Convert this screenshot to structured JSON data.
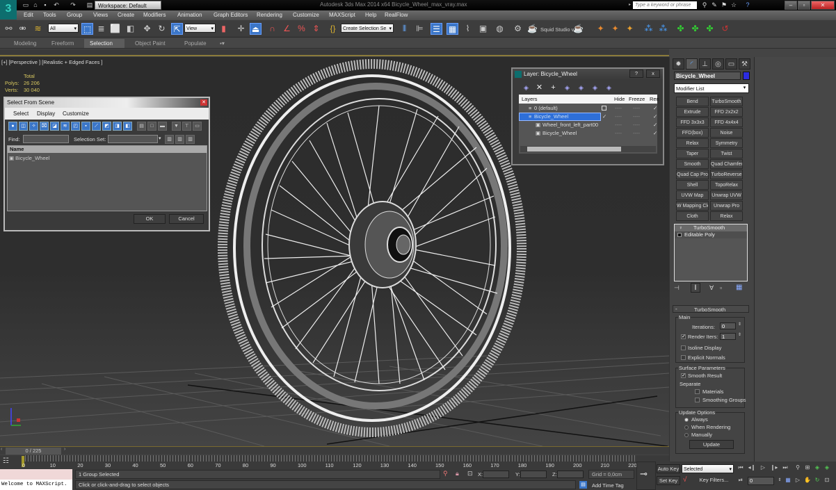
{
  "app": {
    "title": "Autodesk 3ds Max  2014 x64     Bicycle_Wheel_max_vray.max",
    "workspace": "Workspace: Default",
    "search_placeholder": "Type a keyword or phrase",
    "logo": "3"
  },
  "menu": [
    "Edit",
    "Tools",
    "Group",
    "Views",
    "Create",
    "Modifiers",
    "Animation",
    "Graph Editors",
    "Rendering",
    "Customize",
    "MAXScript",
    "Help",
    "RealFlow"
  ],
  "toolbar": {
    "filter": "All",
    "coord_system": "View",
    "selection_set": "Create Selection Se",
    "squid": "Squid Studio v"
  },
  "ribbon": {
    "tabs": [
      "Modeling",
      "Freeform",
      "Selection",
      "Object Paint",
      "Populate"
    ],
    "active": "Selection"
  },
  "viewport": {
    "label": "[+] [Perspective ] [Realistic + Edged Faces ]",
    "stats": {
      "header": "Total",
      "polys_label": "Polys:",
      "polys": "26 206",
      "verts_label": "Verts:",
      "verts": "30 040"
    }
  },
  "select_from_scene": {
    "title": "Select From Scene",
    "menu": [
      "Select",
      "Display",
      "Customize"
    ],
    "find_label": "Find:",
    "selection_set_label": "Selection Set:",
    "column": "Name",
    "items": [
      "Bicycle_Wheel"
    ],
    "ok": "OK",
    "cancel": "Cancel"
  },
  "layer_dialog": {
    "title": "Layer: Bicycle_Wheel",
    "columns": {
      "layers": "Layers",
      "hide": "Hide",
      "freeze": "Freeze",
      "render": "Ren"
    },
    "rows": [
      {
        "name": "0 (default)",
        "hide": "----",
        "freeze": "----",
        "selected": false
      },
      {
        "name": "Bicycle_Wheel",
        "hide": "----",
        "freeze": "----",
        "selected": true
      },
      {
        "name": "Wheel_front_left_part00",
        "hide": "----",
        "freeze": "----",
        "selected": false
      },
      {
        "name": "Bicycle_Wheel",
        "hide": "----",
        "freeze": "----",
        "selected": false
      }
    ],
    "help": "?",
    "close": "x"
  },
  "command_panel": {
    "object_name": "Bicycle_Wheel",
    "object_color": "#2c2ce0",
    "modifier_list": "Modifier List",
    "modifiers": [
      "Bend",
      "TurboSmooth",
      "Extrude",
      "FFD 2x2x2",
      "FFD 3x3x3",
      "FFD 4x4x4",
      "FFD(box)",
      "Noise",
      "Relax",
      "Symmetry",
      "Taper",
      "Twist",
      "Smooth",
      "Quad Chamfer",
      "Quad Cap Pro",
      "TurboReverse",
      "Shell",
      "TopoRelax",
      "UVW Map",
      "Unwrap UVW",
      "W Mapping Cle",
      "Unwrap Pro",
      "Cloth",
      "Relax"
    ],
    "stack": [
      "TurboSmooth",
      "Editable Poly"
    ],
    "rollout": {
      "title": "TurboSmooth",
      "main": "Main",
      "iterations_label": "Iterations:",
      "iterations": "0",
      "render_iters_label": "Render Iters:",
      "render_iters": "1",
      "isoline": "Isoline Display",
      "explicit": "Explicit Normals",
      "surface": "Surface Parameters",
      "smooth_result": "Smooth Result",
      "separate": "Separate",
      "materials": "Materials",
      "smoothing_groups": "Smoothing Groups",
      "update_options": "Update Options",
      "always": "Always",
      "when_rendering": "When Rendering",
      "manually": "Manually",
      "update": "Update"
    }
  },
  "timeline": {
    "frame": "0 / 225",
    "ticks": [
      "0",
      "10",
      "20",
      "30",
      "40",
      "50",
      "60",
      "70",
      "80",
      "90",
      "100",
      "110",
      "120",
      "130",
      "140",
      "150",
      "160",
      "170",
      "180",
      "190",
      "200",
      "210",
      "220"
    ]
  },
  "status": {
    "maxscript": "Welcome to MAXScript.",
    "selection": "1 Group Selected",
    "prompt": "Click or click-and-drag to select objects",
    "x_label": "X:",
    "y_label": "Y:",
    "z_label": "Z:",
    "grid": "Grid = 0,0cm",
    "add_time_tag": "Add Time Tag",
    "auto_key": "Auto Key",
    "set_key": "Set Key",
    "key_mode": "Selected",
    "key_filters": "Key Filters...",
    "current_frame": "0"
  }
}
